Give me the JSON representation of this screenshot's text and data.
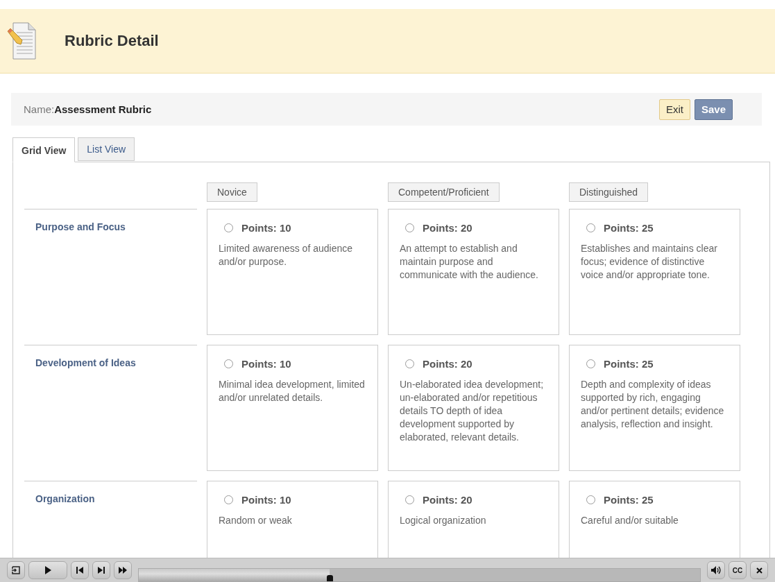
{
  "header": {
    "title": "Rubric Detail"
  },
  "name_bar": {
    "label": "Name:",
    "value": "Assessment Rubric",
    "buttons": [
      {
        "label": "Exit",
        "kind": "secondary"
      },
      {
        "label": "Save",
        "kind": "primary"
      }
    ]
  },
  "tabs": [
    {
      "label": "Grid View",
      "selected": true
    },
    {
      "label": "List View",
      "selected": false
    }
  ],
  "levels": [
    "Novice",
    "Competent/Proficient",
    "Distinguished"
  ],
  "criteria": [
    {
      "name": "Purpose and Focus",
      "cells": [
        {
          "points": "Points: 10",
          "selected": false,
          "description": "Limited awareness of audience and/or purpose."
        },
        {
          "points": "Points: 20",
          "selected": false,
          "description": "An attempt to establish and maintain purpose and communicate with the audience."
        },
        {
          "points": "Points: 25",
          "selected": false,
          "description": "Establishes and maintains clear focus; evidence of distinctive voice and/or appropriate tone."
        }
      ]
    },
    {
      "name": "Development of Ideas",
      "cells": [
        {
          "points": "Points: 10",
          "selected": false,
          "description": "Minimal idea development, limited and/or unrelated details."
        },
        {
          "points": "Points: 20",
          "selected": false,
          "description": "Un-elaborated idea development; un-elaborated and/or repetitious details TO depth of idea development supported by elaborated, relevant details."
        },
        {
          "points": "Points: 25",
          "selected": false,
          "description": "Depth and complexity of ideas supported by rich, engaging and/or pertinent details; evidence analysis, reflection and insight."
        }
      ]
    },
    {
      "name": "Organization",
      "cells": [
        {
          "points": "Points: 10",
          "selected": false,
          "description": "Random or weak"
        },
        {
          "points": "Points: 20",
          "selected": false,
          "description": "Logical organization"
        },
        {
          "points": "Points: 25",
          "selected": false,
          "description": "Careful and/or suitable"
        }
      ]
    }
  ],
  "player": {
    "level": 0.34,
    "cc_label": "CC"
  }
}
